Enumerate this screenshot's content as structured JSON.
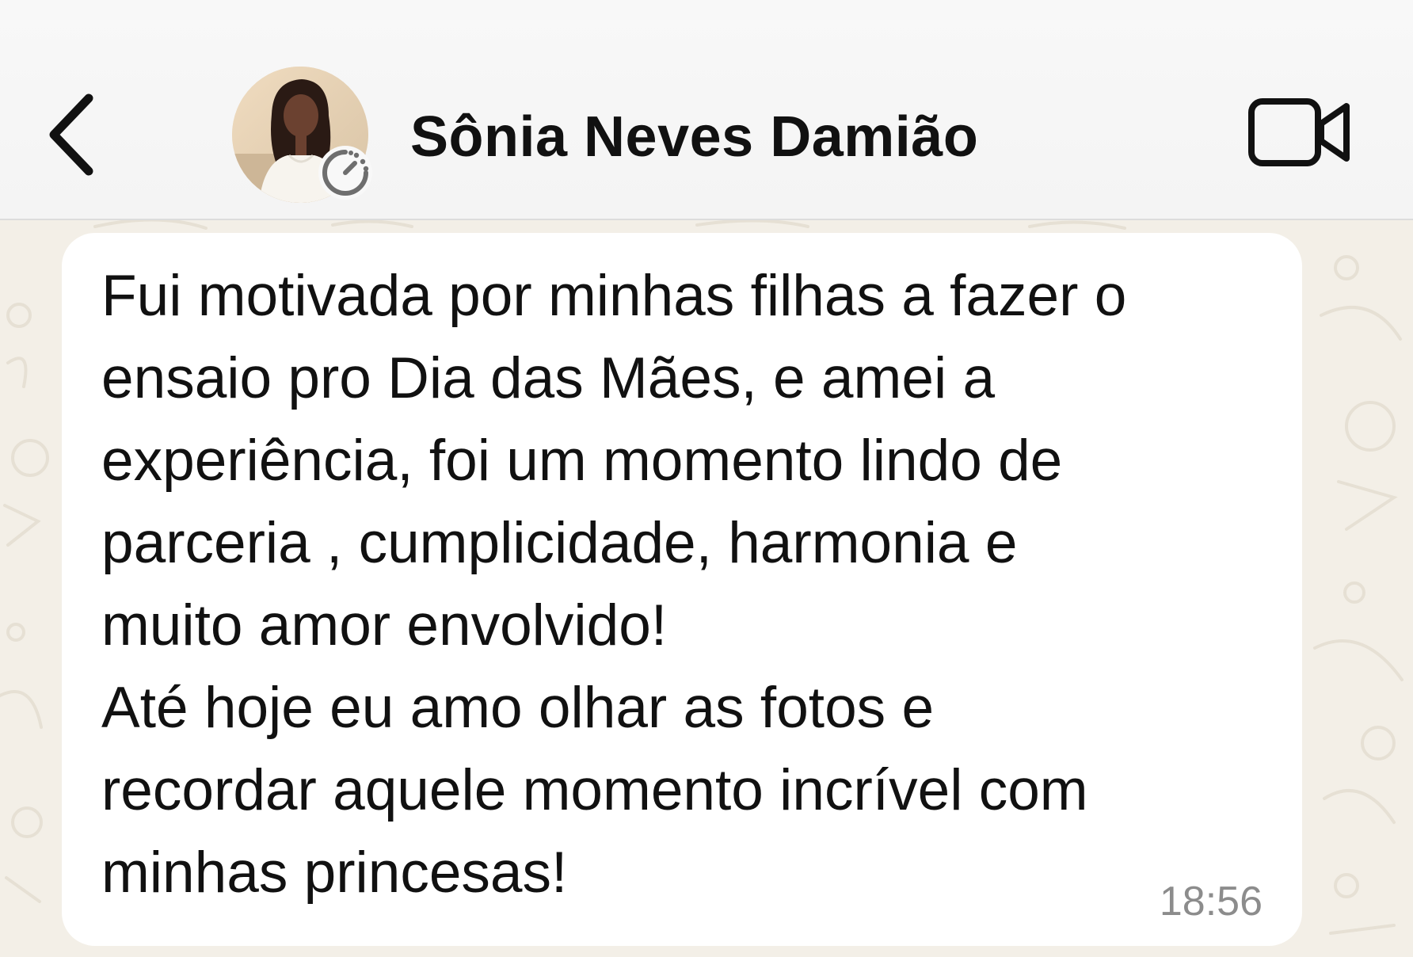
{
  "header": {
    "back_icon": "chevron-left-icon",
    "contact_name": "Sônia Neves Damião",
    "avatar_badge_icon": "disappearing-timer-icon",
    "video_icon": "video-camera-icon"
  },
  "message": {
    "lines": [
      "Fui motivada por minhas filhas a fazer o",
      "ensaio pro Dia das Mães, e amei a",
      "experiência, foi um momento lindo de",
      "parceria , cumplicidade, harmonia e",
      "muito amor envolvido!",
      "Até hoje eu amo olhar as fotos e",
      "recordar aquele momento incrível com",
      "minhas princesas!"
    ],
    "time": "18:56"
  },
  "colors": {
    "header_bg": "#f6f6f6",
    "chat_bg": "#f3efe7",
    "bubble_bg": "#ffffff",
    "text": "#111111",
    "time_text": "#8c8c8c"
  }
}
